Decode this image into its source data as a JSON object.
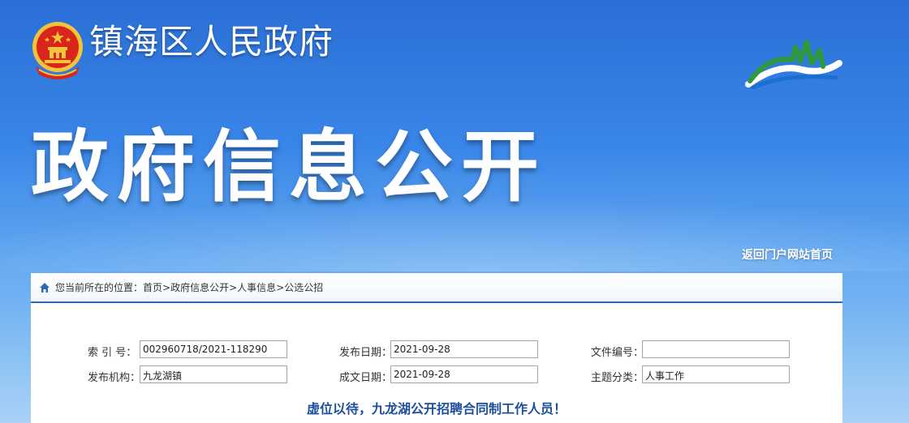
{
  "header": {
    "site_name": "镇海区人民政府",
    "section_title": "政府信息公开",
    "home_link": "返回门户网站首页"
  },
  "breadcrumb": {
    "prefix": "您当前所在的位置：",
    "items": [
      "首页",
      "政府信息公开",
      "人事信息",
      "公选公招"
    ],
    "separator": ">"
  },
  "meta": {
    "index_label": "索 引 号：",
    "index_value": "002960718/2021-118290",
    "publish_date_label": "发布日期：",
    "publish_date_value": "2021-09-28",
    "doc_number_label": "文件编号：",
    "doc_number_value": "",
    "org_label": "发布机构：",
    "org_value": "九龙湖镇",
    "created_date_label": "成文日期：",
    "created_date_value": "2021-09-28",
    "topic_label": "主题分类：",
    "topic_value": "人事工作"
  },
  "document": {
    "title": "虚位以待，九龙湖公开招聘合同制工作人员！"
  },
  "colors": {
    "banner_blue": "#2a6fd6",
    "accent_line": "#2b6bb5",
    "title_blue": "#1d4f9c",
    "emblem_red": "#d9261c",
    "emblem_gold": "#f3c33a"
  }
}
